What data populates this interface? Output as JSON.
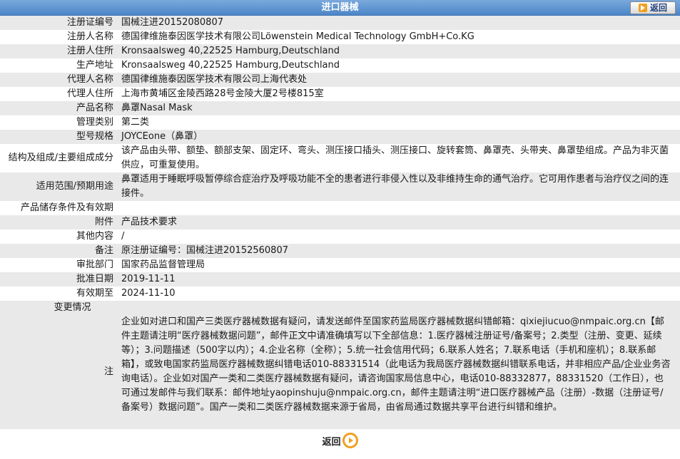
{
  "header": {
    "title": "进口器械",
    "back_label": "返回"
  },
  "rows": [
    {
      "label": "注册证编号",
      "value": "国械注进20152080807"
    },
    {
      "label": "注册人名称",
      "value": "德国律维施泰因医学技术有限公司Löwenstein Medical Technology GmbH+Co.KG"
    },
    {
      "label": "注册人住所",
      "value": "Kronsaalsweg 40,22525 Hamburg,Deutschland"
    },
    {
      "label": "生产地址",
      "value": "Kronsaalsweg 40,22525 Hamburg,Deutschland"
    },
    {
      "label": "代理人名称",
      "value": "德国律维施泰因医学技术有限公司上海代表处"
    },
    {
      "label": "代理人住所",
      "value": "上海市黄埔区金陵西路28号金陵大厦2号楼815室"
    },
    {
      "label": "产品名称",
      "value": "鼻罩Nasal Mask"
    },
    {
      "label": "管理类别",
      "value": "第二类"
    },
    {
      "label": "型号规格",
      "value": "JOYCEone（鼻罩）"
    },
    {
      "label": "结构及组成/主要组成成分",
      "value": "该产品由头带、额垫、额部支架、固定环、弯头、测压接口插头、测压接口、旋转套筒、鼻罩壳、头带夹、鼻罩垫组成。产品为非灭菌供应，可重复使用。"
    },
    {
      "label": "适用范围/预期用途",
      "value": "鼻罩适用于睡眠呼吸暂停综合症治疗及呼吸功能不全的患者进行非侵入性以及非维持生命的通气治疗。它可用作患者与治疗仪之间的连接件。"
    },
    {
      "label": "产品储存条件及有效期",
      "value": ""
    },
    {
      "label": "附件",
      "value": "产品技术要求"
    },
    {
      "label": "其他内容",
      "value": "/"
    },
    {
      "label": "备注",
      "value": "原注册证编号：国械注进20152560807"
    },
    {
      "label": "审批部门",
      "value": "国家药品监督管理局"
    },
    {
      "label": "批准日期",
      "value": "2019-11-11"
    },
    {
      "label": "有效期至",
      "value": "2024-11-10"
    },
    {
      "label": "变更情况",
      "value": ""
    }
  ],
  "note": {
    "label": "注",
    "text": "企业如对进口和国产三类医疗器械数据有疑问，请发送邮件至国家药监局医疗器械数据纠错邮箱：qixiejiucuo@nmpaic.org.cn【邮件主题请注明“医疗器械数据问题”，邮件正文中请准确填写以下全部信息：1.医疗器械注册证号/备案号；2.类型（注册、变更、延续等）；3.问题描述（500字以内）；4.企业名称（全称）；5.统一社会信用代码；6.联系人姓名；7.联系电话（手机和座机）；8.联系邮箱】，或致电国家药监局医疗器械数据纠错电话010-88331514（此电话为我局医疗器械数据纠错联系电话，并非相应产品/企业业务咨询电话）。企业如对国产一类和二类医疗器械数据有疑问，请咨询国家局信息中心，电话010-88332877，88331520（工作日），也可通过发邮件与我们联系：邮件地址yaopinshuju@nmpaic.org.cn，邮件主题请注明“进口医疗器械产品（注册）-数据（注册证号/备案号）数据问题”。国产一类和二类医疗器械数据来源于省局，由省局通过数据共享平台进行纠错和维护。"
  },
  "footer": {
    "back_label": "返回"
  }
}
